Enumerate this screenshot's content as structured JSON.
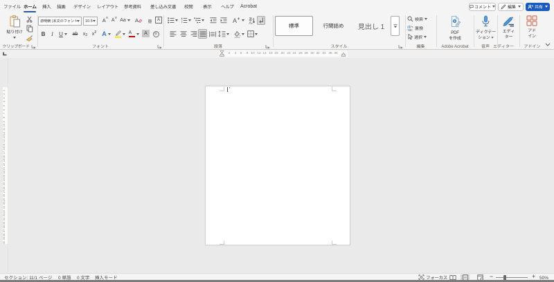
{
  "tabbar": {
    "tabs": [
      {
        "id": "file",
        "label": "ファイル",
        "active": false
      },
      {
        "id": "home",
        "label": "ホーム",
        "active": true
      },
      {
        "id": "insert",
        "label": "挿入",
        "active": false
      },
      {
        "id": "draw",
        "label": "描画",
        "active": false
      },
      {
        "id": "design",
        "label": "デザイン",
        "active": false
      },
      {
        "id": "layout",
        "label": "レイアウト",
        "active": false
      },
      {
        "id": "references",
        "label": "参考資料",
        "active": false
      },
      {
        "id": "mailings",
        "label": "差し込み文書",
        "active": false
      },
      {
        "id": "review",
        "label": "校閲",
        "active": false
      },
      {
        "id": "view",
        "label": "表示",
        "active": false
      },
      {
        "id": "help",
        "label": "ヘルプ",
        "active": false
      },
      {
        "id": "acrobat",
        "label": "Acrobat",
        "active": false
      }
    ],
    "actions": {
      "comments": "コメント",
      "editing": "編集",
      "share": "共有"
    }
  },
  "ribbon": {
    "clipboard": {
      "label": "クリップボード",
      "paste": "貼り付け"
    },
    "font": {
      "label": "フォント",
      "font_name": "游明朝 (本文のフォント",
      "font_size": "10.5",
      "glyphs": {
        "grow": "A",
        "shrink": "A",
        "case": "Aa",
        "clear": "A",
        "ruby": "亜",
        "box": "A",
        "bold": "B",
        "italic": "I",
        "underline": "U",
        "strike": "ab",
        "sub_base": "x",
        "sub_mark": "2",
        "sup_base": "x",
        "sup_mark": "2",
        "effects": "A",
        "color": "A",
        "shade": "A",
        "enclose": "亜"
      }
    },
    "paragraph": {
      "label": "段落"
    },
    "styles": {
      "label": "スタイル",
      "items": [
        {
          "name": "標準",
          "selected": true
        },
        {
          "name": "行間詰め",
          "selected": false
        },
        {
          "name": "見出し 1",
          "selected": false
        }
      ]
    },
    "editing": {
      "label": "編集",
      "find": "検索",
      "replace": "置換",
      "select": "選択"
    },
    "acrobat": {
      "label": "Adobe Acrobat",
      "create_pdf": [
        "PDF",
        "を作成"
      ]
    },
    "voice": {
      "label": "音声",
      "dictate": [
        "ディクテー",
        "ション"
      ]
    },
    "editor": {
      "label": "エディター",
      "button": [
        "エディ",
        "ター"
      ]
    },
    "addins": {
      "label": "アドイン",
      "button": [
        "アド",
        "イン"
      ]
    }
  },
  "ruler": {
    "h_numbers": [
      2,
      4,
      6,
      8,
      10,
      12,
      14,
      16,
      18,
      20,
      22,
      24,
      26,
      28,
      30,
      32,
      34,
      36,
      38
    ],
    "v_numbers": [
      1,
      2,
      3,
      4,
      5,
      6,
      7,
      8,
      9,
      10,
      11,
      12,
      13,
      14,
      15,
      16,
      17,
      18,
      19,
      20,
      21,
      22,
      23,
      24,
      25,
      26,
      27,
      28,
      29,
      30,
      31,
      32,
      33,
      34,
      35,
      36,
      37,
      38,
      39,
      40
    ]
  },
  "statusbar": {
    "left": [
      "セクション: 1",
      "1/1 ページ",
      "0 単語",
      "0 文字",
      "挿入モード"
    ],
    "focus": "フォーカス",
    "zoom_out": "−",
    "zoom_in": "+",
    "zoom": "50%"
  },
  "colors": {
    "accent": "#185abd",
    "tab_underline": "#2b579a"
  }
}
